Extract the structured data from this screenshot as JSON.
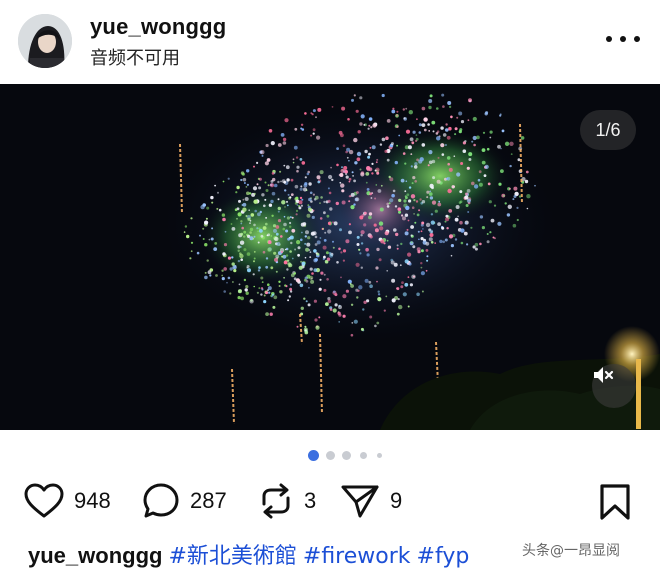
{
  "header": {
    "username": "yue_wonggg",
    "subtitle": "音频不可用",
    "more_icon": "more-horizontal-icon"
  },
  "media": {
    "counter": "1/6",
    "mute_icon": "volume-muted-icon",
    "carousel": {
      "total": 6,
      "current": 1,
      "visible_dots": 5
    }
  },
  "actions": {
    "likes": "948",
    "comments": "287",
    "reposts": "3",
    "shares": "9",
    "icons": [
      "heart-icon",
      "comment-icon",
      "repost-icon",
      "send-icon",
      "bookmark-icon"
    ]
  },
  "caption": {
    "username": "yue_wonggg",
    "tags": [
      "#新北美術館",
      "#firework",
      "#fyp"
    ]
  },
  "watermark": "头条@一昂显阅",
  "colors": {
    "accent": "#3b6fe0",
    "hashtag": "#1c4fd6",
    "inactive_dot": "#c9ccd2"
  }
}
